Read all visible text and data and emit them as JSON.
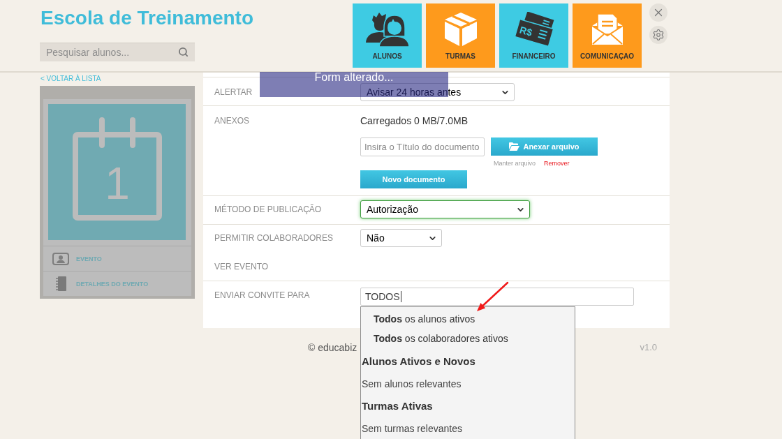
{
  "header": {
    "title": "Escola de Treinamento",
    "search": {
      "placeholder": "Pesquisar alunos..."
    }
  },
  "nav_tiles": [
    {
      "label": "ALUNOS",
      "color": "#3ecbe3"
    },
    {
      "label": "TURMAS",
      "color": "#fe9a1c"
    },
    {
      "label": "FINANCEIRO",
      "color": "#3ecbe3",
      "icon_text": "R$"
    },
    {
      "label": "COMUNICAÇAO",
      "color": "#fe9a1c"
    }
  ],
  "sidebar": {
    "back_link": "< VOLTAR À LISTA",
    "picture_text": "1",
    "items": [
      {
        "label": "EVENTO"
      },
      {
        "label": "DETALHES DO EVENTO"
      }
    ]
  },
  "banner": {
    "text": "Form alterado..."
  },
  "form": {
    "rows": [
      {
        "kind": "select",
        "label": "ALERTAR",
        "value": "Avisar 24 horas antes",
        "focused": false
      },
      {
        "kind": "attachments",
        "label": "ANEXOS",
        "usage": "Carregados 0 MB/7.0MB",
        "title_field": {
          "placeholder": "Insira o Título do documento"
        },
        "attach_button": "Anexar arquivo",
        "keep_link": "Manter arquivo",
        "remove_link": "Remover",
        "new_button": "Novo documento"
      },
      {
        "kind": "select",
        "label": "MÉTODO DE PUBLICAÇÃO",
        "value": "Autorização",
        "focused": true
      },
      {
        "kind": "select",
        "label": "PERMITIR COLABORADORES",
        "value": "Não",
        "focused": false
      },
      {
        "kind": "heading",
        "label": "VER EVENTO"
      },
      {
        "kind": "autocomplete",
        "label": "ENVIAR CONVITE PARA",
        "value": "TODOS",
        "focused": true,
        "suggestions": [
          {
            "kind": "option",
            "text": "**Todos** os alunos ativos"
          },
          {
            "kind": "option",
            "text": "**Todos** os colaboradores ativos"
          },
          {
            "kind": "group",
            "text": "Alunos Ativos e Novos"
          },
          {
            "kind": "empty",
            "text": "Sem alunos relevantes"
          },
          {
            "kind": "group",
            "text": "Turmas Ativas"
          },
          {
            "kind": "empty",
            "text": "Sem turmas relevantes"
          }
        ]
      }
    ]
  },
  "footer": {
    "copyright": "© educabiz",
    "version": "v1.0"
  }
}
